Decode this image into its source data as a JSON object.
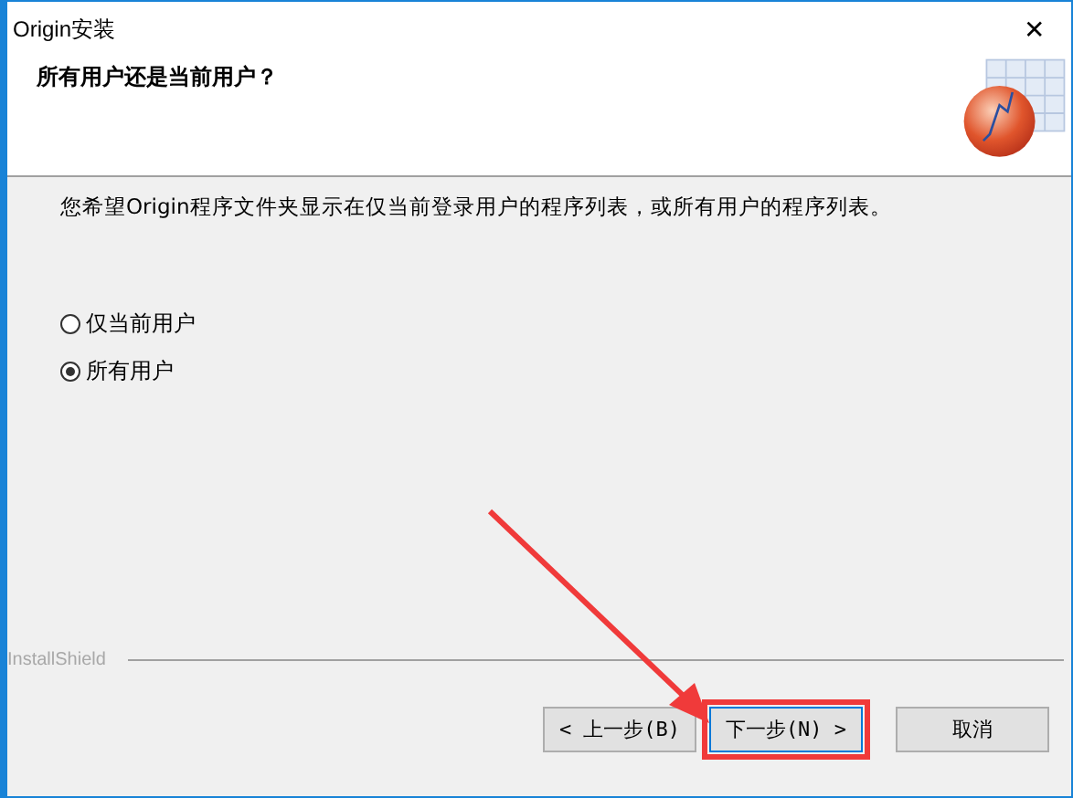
{
  "window": {
    "title": "Origin安装",
    "close": "✕"
  },
  "header": {
    "heading": "所有用户还是当前用户？"
  },
  "description": "您希望Origin程序文件夹显示在仅当前登录用户的程序列表，或所有用户的程序列表。",
  "options": [
    {
      "label": "仅当前用户",
      "selected": false
    },
    {
      "label": "所有用户",
      "selected": true
    }
  ],
  "brand": "InstallShield",
  "buttons": [
    {
      "label": "< 上一步(B)",
      "highlighted": false
    },
    {
      "label": "下一步(N) >",
      "highlighted": true
    },
    {
      "label": "取消",
      "highlighted": false
    }
  ]
}
